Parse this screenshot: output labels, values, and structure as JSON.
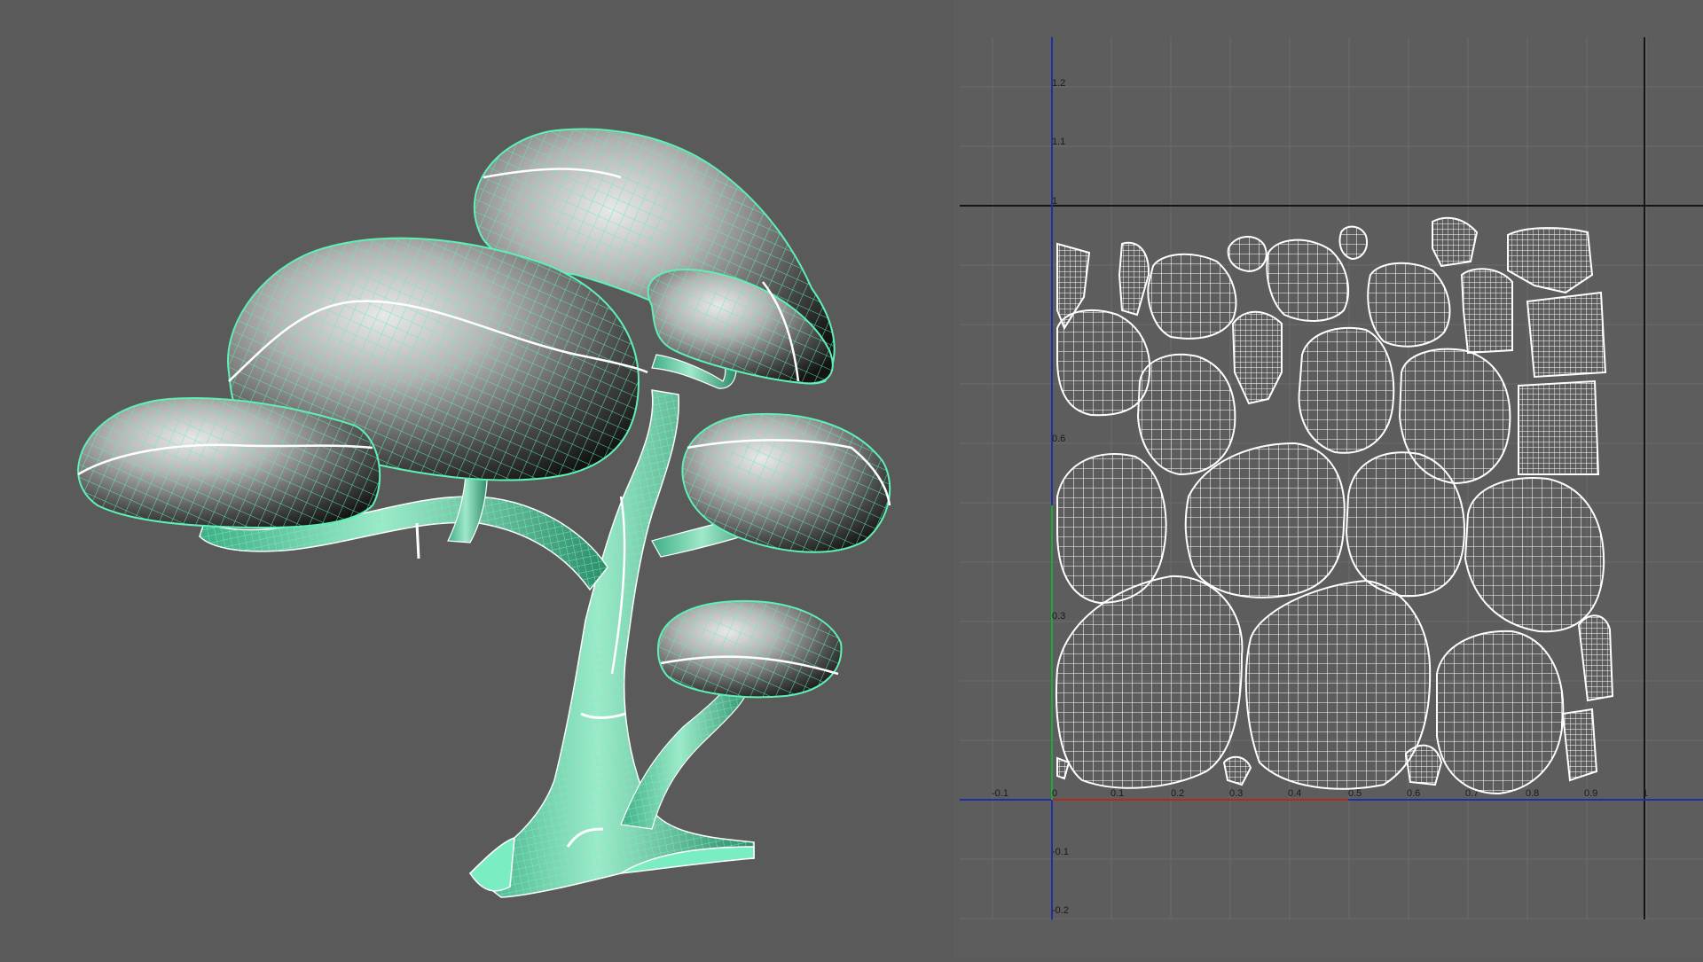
{
  "viewport": {
    "name": "3D perspective viewport",
    "object": "stylized tree mesh with UV seams"
  },
  "uv_editor": {
    "axes": {
      "u_ticks": [
        "-0.1",
        "0",
        "0.1",
        "0.2",
        "0.3",
        "0.4",
        "0.5",
        "0.6",
        "0.7",
        "0.8",
        "0.9",
        "1"
      ],
      "v_ticks": [
        "-0.2",
        "-0.1",
        "0.3",
        "0.6",
        "1",
        "1.1",
        "1.2"
      ]
    },
    "colors": {
      "background": "#5d5d5d",
      "grid": "#6c6c6c",
      "v_axis": "#1f2fa8",
      "u_axis_positive": "#b02a1f",
      "v_axis_positive": "#1fa83a",
      "uv_wire": "#ffffff",
      "mesh_wire": "#5ef0b4"
    }
  }
}
